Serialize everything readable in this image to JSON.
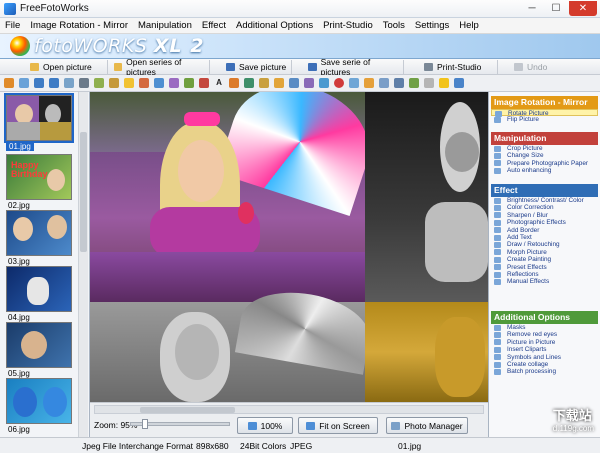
{
  "window": {
    "title": "FreeFotoWorks",
    "controls": [
      "─",
      "☐",
      "✕"
    ]
  },
  "menu": [
    "File",
    "Image Rotation - Mirror",
    "Manipulation",
    "Effect",
    "Additional Options",
    "Print-Studio",
    "Tools",
    "Settings",
    "Help"
  ],
  "banner": {
    "logo_text": "fotoWORKS",
    "logo_suffix": "XL 2"
  },
  "toolbar": {
    "open_picture": "Open picture",
    "open_series": "Open series of pictures",
    "save_picture": "Save picture",
    "save_series": "Save serie of pictures",
    "print_studio": "Print-Studio",
    "undo": "Undo"
  },
  "thumbnails": [
    {
      "name": "01.jpg",
      "selected": true
    },
    {
      "name": "02.jpg",
      "selected": false
    },
    {
      "name": "03.jpg",
      "selected": false
    },
    {
      "name": "04.jpg",
      "selected": false
    },
    {
      "name": "05.jpg",
      "selected": false
    },
    {
      "name": "06.jpg",
      "selected": false
    }
  ],
  "thumb_overlay_text": "Happy Birthday",
  "right_panel": {
    "sections": [
      {
        "title": "Image Rotation - Mirror",
        "color": "#e39a16",
        "items": [
          "Rotate Picture",
          "Flip Picture"
        ]
      },
      {
        "title": "Manipulation",
        "color": "#c2413b",
        "items": [
          "Crop Picture",
          "Change Size",
          "Prepare Photographic Paper",
          "Auto enhancing"
        ]
      },
      {
        "title": "Effect",
        "color": "#2f6db5",
        "items": [
          "Brightness/ Contrast/ Color",
          "Color Correction",
          "Sharpen / Blur",
          "Photographic Effects",
          "Add Border",
          "Add Text",
          "Draw / Retouching",
          "Morph Picture",
          "Create Painting",
          "Preset Effects",
          "Reflections",
          "Manual Effects"
        ]
      },
      {
        "title": "Additional Options",
        "color": "#4f9a3a",
        "items": [
          "Masks",
          "Remove red eyes",
          "Picture in Picture",
          "Insert Cliparts",
          "Symbols and Lines",
          "Create collage",
          "Batch processing"
        ]
      }
    ]
  },
  "bottom": {
    "zoom_label": "Zoom: 95%",
    "zoom_value": 0.95,
    "btn_100": "100%",
    "btn_fit": "Fit on Screen",
    "btn_manager": "Photo Manager"
  },
  "status": {
    "format": "Jpeg File Interchange Format",
    "dimensions": "898x680",
    "colors": "24Bit Colors",
    "type": "JPEG",
    "filename": "01.jpg"
  },
  "watermark": {
    "line1": "下载站",
    "line2": "d.119g.com"
  }
}
